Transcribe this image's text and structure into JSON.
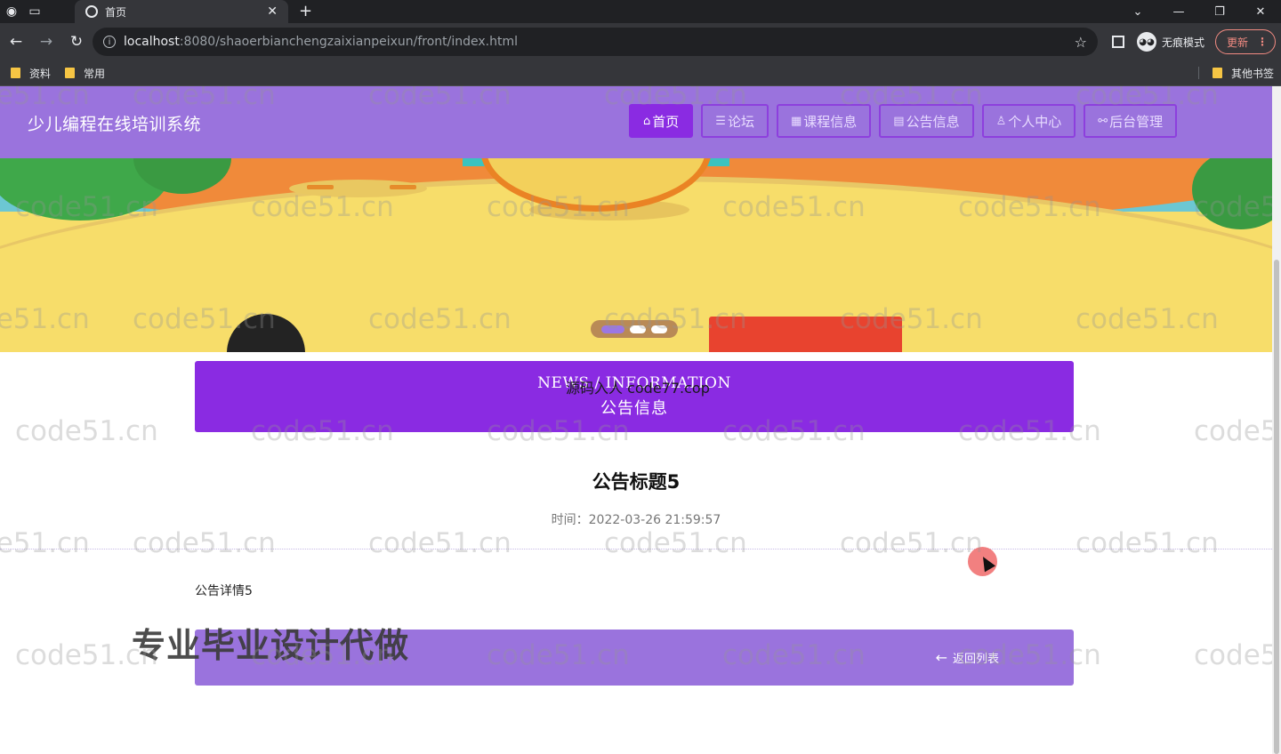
{
  "browser": {
    "tab_title": "首页",
    "url_host": "localhost",
    "url_path": ":8080/shaoerbianchengzaixianpeixun/front/index.html",
    "incognito_label": "无痕模式",
    "update_label": "更新",
    "bookmarks": [
      {
        "label": "资料"
      },
      {
        "label": "常用"
      }
    ],
    "other_bookmarks": "其他书签"
  },
  "site": {
    "title": "少儿编程在线培训系统",
    "nav": [
      {
        "label": "首页",
        "icon": "home-icon",
        "active": true
      },
      {
        "label": "论坛",
        "icon": "forum-icon",
        "active": false
      },
      {
        "label": "课程信息",
        "icon": "course-icon",
        "active": false
      },
      {
        "label": "公告信息",
        "icon": "notice-icon",
        "active": false
      },
      {
        "label": "个人中心",
        "icon": "user-icon",
        "active": false
      },
      {
        "label": "后台管理",
        "icon": "link-icon",
        "active": false
      }
    ]
  },
  "section": {
    "english": "NEWS / INFORMATION",
    "chinese": "公告信息"
  },
  "overlay_source": "源码入人 code77.cop",
  "notice": {
    "title": "公告标题5",
    "time_label": "时间：",
    "time_value": "2022-03-26 21:59:57",
    "detail": "公告详情5"
  },
  "back_label": "返回列表",
  "promo_text": "专业毕业设计代做",
  "watermark_text": "code51.cn",
  "colors": {
    "header": "#9a73dd",
    "accent": "#8a2be2"
  }
}
